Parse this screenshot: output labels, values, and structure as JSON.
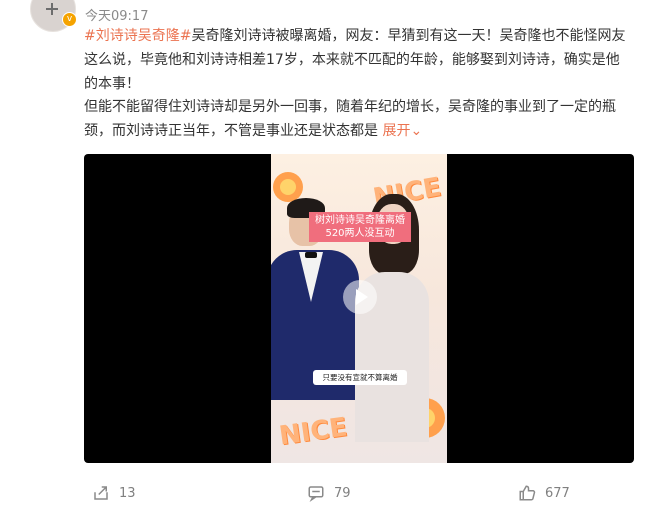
{
  "post": {
    "time": "今天09:17",
    "tag1": "#刘诗诗",
    "tag2": "吴奇隆#",
    "line1_rest": "吴奇隆刘诗诗被曝离婚，网友：早猜到有这一天！吴奇隆也不能怪网友",
    "line2": "这么说，毕竟他和刘诗诗相差17岁，本来就不匹配的年龄，能够娶到刘诗诗，确实是他",
    "line3": "的本事！",
    "line4": "但能不能留得住刘诗诗却是另外一回事，随着年纪的增长，吴奇隆的事业到了一定的瓶",
    "line5": "颈，而刘诗诗正当年，不管是事业还是状态都是",
    "expand_label": "展开",
    "expand_icon": "chevron-down"
  },
  "video": {
    "title_line1": "树刘诗诗吴奇隆离婚",
    "title_line2": "520两人没互动",
    "subtitle": "只要没有宣就不算离婚",
    "sticker_top": "NICE",
    "sticker_bottom": "NICE"
  },
  "actions": {
    "share_count": "13",
    "comment_count": "79",
    "like_count": "677"
  }
}
